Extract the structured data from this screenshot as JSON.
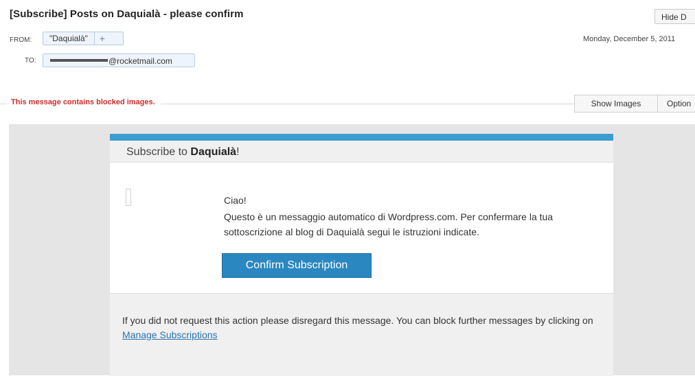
{
  "email": {
    "subject": "[Subscribe] Posts on Daquialà - please confirm",
    "hide_button": "Hide D",
    "from_label": "FROM:",
    "from_name": "\"Daquialà\"",
    "from_add": "+",
    "to_label": "TO:",
    "to_address": "@rocketmail.com",
    "date": "Monday, December 5, 2011"
  },
  "notice": {
    "blocked_text": "This message contains blocked images.",
    "show_images": "Show Images",
    "options": "Option"
  },
  "message": {
    "title_prefix": "Subscribe to ",
    "title_blog": "Daquialà",
    "title_suffix": "!",
    "greeting": "Ciao!",
    "body": "Questo è un messaggio automatico di Wordpress.com. Per confermare la tua sottoscrizione al blog di Daquialà segui le istruzioni indicate.",
    "confirm_button": "Confirm Subscription",
    "footer_text": "If you did not request this action please disregard this message. You can block further messages by clicking on ",
    "footer_link": "Manage Subscriptions"
  },
  "colors": {
    "accent": "#3d9dd1",
    "button": "#2a87bf",
    "warning": "#cc2b2b",
    "link": "#2a73b0"
  }
}
